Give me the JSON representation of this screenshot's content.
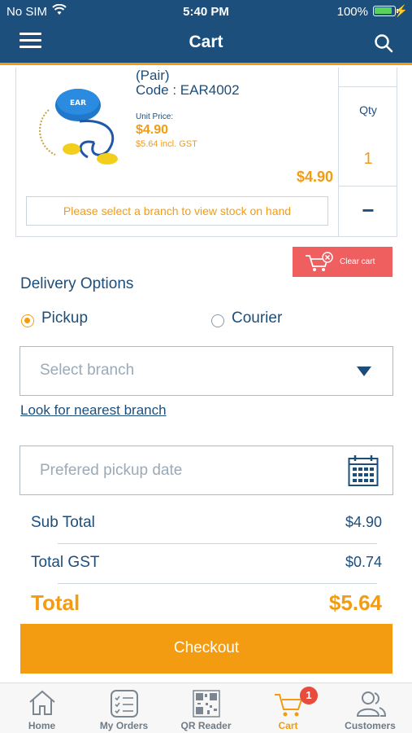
{
  "status_bar": {
    "carrier": "No SIM",
    "time": "5:40 PM",
    "battery": "100%"
  },
  "nav": {
    "title": "Cart"
  },
  "product": {
    "name": "(Pair)",
    "code": "Code : EAR4002",
    "unit_price_label": "Unit Price:",
    "unit_price": "$4.90",
    "incl_gst": "$5.64 incl. GST",
    "line_total": "$4.90",
    "stock_message": "Please select a branch to view stock on hand",
    "qty_label": "Qty",
    "qty_value": "1",
    "minus_label": "−",
    "thumb_brand": "EAR"
  },
  "clear_cart": {
    "label": "Clear cart"
  },
  "delivery": {
    "title": "Delivery Options",
    "options": [
      {
        "label": "Pickup",
        "selected": true
      },
      {
        "label": "Courier",
        "selected": false
      }
    ],
    "branch_placeholder": "Select branch",
    "nearest_link": "Look for nearest branch",
    "date_placeholder": "Prefered pickup date"
  },
  "totals": {
    "subtotal_label": "Sub Total",
    "subtotal": "$4.90",
    "gst_label": "Total GST",
    "gst": "$0.74",
    "total_label": "Total",
    "total": "$5.64"
  },
  "checkout": {
    "label": "Checkout"
  },
  "tabs": [
    {
      "label": "Home",
      "icon": "home-icon"
    },
    {
      "label": "My Orders",
      "icon": "orders-icon"
    },
    {
      "label": "QR Reader",
      "icon": "qr-icon"
    },
    {
      "label": "Cart",
      "icon": "cart-icon",
      "badge": "1",
      "active": true
    },
    {
      "label": "Customers",
      "icon": "customers-icon"
    }
  ],
  "colors": {
    "header": "#1c4f7c",
    "accent": "#f39c12",
    "danger": "#ef5f5f",
    "text": "#1d4e7b"
  }
}
